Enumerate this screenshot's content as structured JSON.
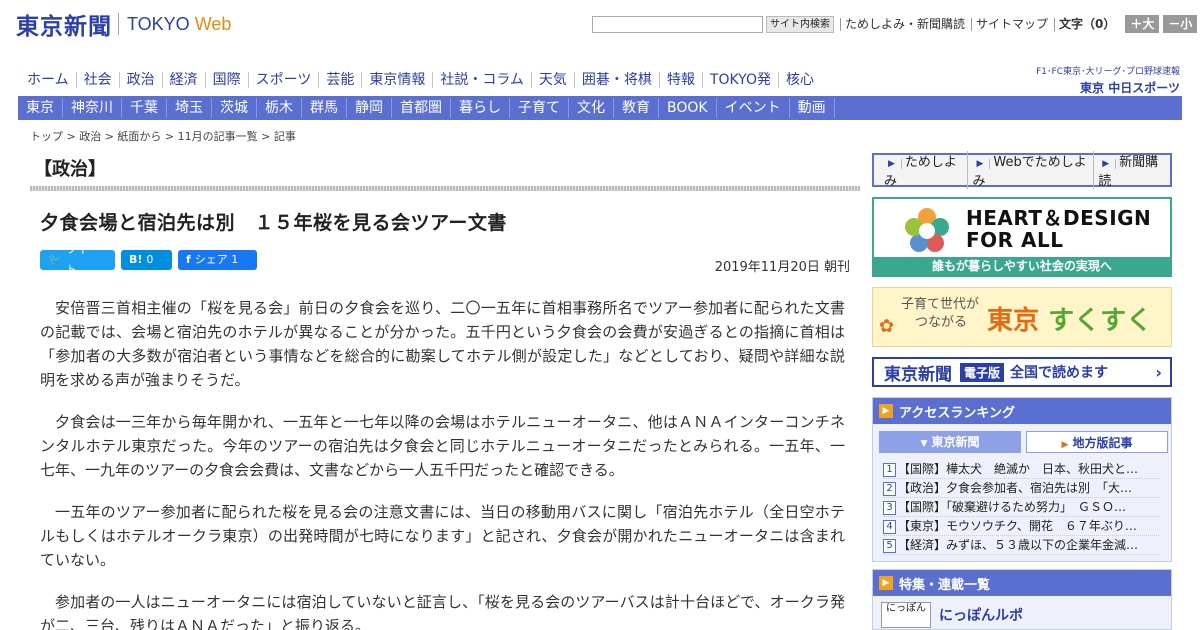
{
  "header": {
    "logo_jp": "東京新聞",
    "logo_en": "TOKYO",
    "logo_web": "Web",
    "search_button": "サイト内検索",
    "search_placeholder": "",
    "links": [
      "ためしよみ・新聞購読",
      "サイトマップ"
    ],
    "font_size_label": "文字（0）",
    "font_plus": "＋大",
    "font_minus": "－小"
  },
  "main_nav": [
    "ホーム",
    "社会",
    "政治",
    "経済",
    "国際",
    "スポーツ",
    "芸能",
    "東京情報",
    "社説・コラム",
    "天気",
    "囲碁・将棋",
    "特報",
    "TOKYO発",
    "核心"
  ],
  "chunichi": {
    "top": "F1･FC東京･大リーグ･プロ野球速報",
    "bottom_prefix": "東京",
    "bottom_name": "中日スポーツ"
  },
  "region_nav": [
    "東京",
    "神奈川",
    "千葉",
    "埼玉",
    "茨城",
    "栃木",
    "群馬",
    "静岡",
    "首都圏",
    "暮らし",
    "子育て",
    "文化",
    "教育",
    "BOOK",
    "イベント",
    "動画"
  ],
  "breadcrumb": "トップ > 政治 > 紙面から > 11月の記事一覧 > 記事",
  "article": {
    "section": "【政治】",
    "headline": "夕食会場と宿泊先は別　１５年桜を見る会ツアー文書",
    "share": {
      "tweet": "ツイート",
      "hatena": "0",
      "facebook": "シェア 1"
    },
    "date": "2019年11月20日 朝刊",
    "paragraphs": [
      "安倍晋三首相主催の「桜を見る会」前日の夕食会を巡り、二〇一五年に首相事務所名でツアー参加者に配られた文書の記載では、会場と宿泊先のホテルが異なることが分かった。五千円という夕食会の会費が安過ぎるとの指摘に首相は「参加者の大多数が宿泊者という事情などを総合的に勘案してホテル側が設定した」などとしており、疑問や詳細な説明を求める声が強まりそうだ。",
      "夕食会は一三年から毎年開かれ、一五年と一七年以降の会場はホテルニューオータニ、他はＡＮＡインターコンチネンタルホテル東京だった。今年のツアーの宿泊先は夕食会と同じホテルニューオータニだったとみられる。一五年、一七年、一九年のツアーの夕食会会費は、文書などから一人五千円だったと確認できる。",
      "一五年のツアー参加者に配られた桜を見る会の注意文書には、当日の移動用バスに関し「宿泊先ホテル（全日空ホテルもしくはホテルオークラ東京）の出発時間が七時になります」と記され、夕食会が開かれたニューオータニは含まれていない。",
      "参加者の一人はニューオータニには宿泊していないと証言し、「桜を見る会のツアーバスは計十台ほどで、オークラ発が二、三台、残りはＡＮＡだった」と振り返る。"
    ]
  },
  "sidebar": {
    "tameshi": [
      "ためしよみ",
      "Webでためしよみ",
      "新聞購読"
    ],
    "hdfa": {
      "title_line1": "HEART＆DESIGN",
      "title_line2": "FOR ALL",
      "caption": "誰もが暮らしやすい社会の実現へ"
    },
    "sukusuku": {
      "sub_line1": "子育て世代が",
      "sub_line2": "つながる",
      "title_a": "東京",
      "title_b": "すくすく"
    },
    "denshi": {
      "name": "東京新聞",
      "tag": "電子版",
      "text": "全国で読めます"
    },
    "ranking": {
      "title": "アクセスランキング",
      "tabs": [
        "東京新聞",
        "地方版記事"
      ],
      "items": [
        {
          "no": "1",
          "text": "【国際】樺太犬　絶滅か　日本、秋田犬と…"
        },
        {
          "no": "2",
          "text": "【政治】夕食会参加者、宿泊先は別　「大…"
        },
        {
          "no": "3",
          "text": "【国際】「破棄避けるため努力」　ＧＳＯ…"
        },
        {
          "no": "4",
          "text": "【東京】モウソウチク、開花　６７年ぶり…"
        },
        {
          "no": "5",
          "text": "【経済】みずほ、５３歳以下の企業年金減…"
        }
      ]
    },
    "tokushu": {
      "title": "特集・連載一覧",
      "thumb": "にっぽん",
      "label": "にっぽんルポ"
    }
  },
  "colors": {
    "brand_blue": "#2b3fa8",
    "nav_bar": "#5a6fd0",
    "accent_orange": "#e88a0c",
    "hdfa_green": "#3aa88f"
  }
}
